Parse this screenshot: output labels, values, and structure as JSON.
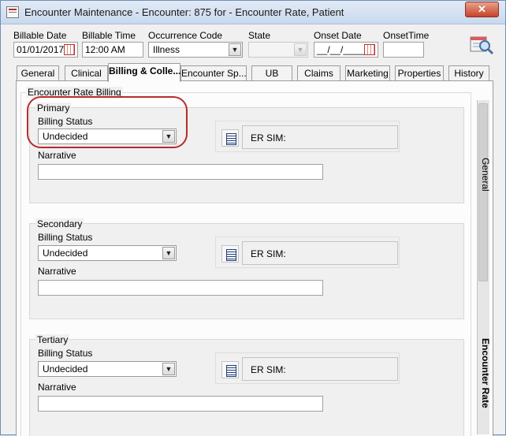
{
  "window": {
    "title": "Encounter Maintenance - Encounter: 875 for - Encounter Rate, Patient",
    "close_glyph": "✕"
  },
  "header_fields": {
    "billable_date": {
      "label": "Billable Date",
      "value": "01/01/2017"
    },
    "billable_time": {
      "label": "Billable Time",
      "value": "12:00 AM"
    },
    "occurrence_code": {
      "label": "Occurrence Code",
      "value": "Illness"
    },
    "state": {
      "label": "State",
      "value": ""
    },
    "onset_date": {
      "label": "Onset Date",
      "value": "__/__/____"
    },
    "onset_time": {
      "label": "OnsetTime",
      "value": ""
    }
  },
  "tabs": [
    {
      "label": "General"
    },
    {
      "label": "Clinical"
    },
    {
      "label": "Billing & Colle..."
    },
    {
      "label": "Encounter  Sp..."
    },
    {
      "label": "UB"
    },
    {
      "label": "Claims"
    },
    {
      "label": "Marketing"
    },
    {
      "label": "Properties"
    },
    {
      "label": "History"
    }
  ],
  "active_tab": "Billing & Colle...",
  "panel": {
    "group_title": "Encounter Rate Billing",
    "sections": [
      {
        "title": "Primary",
        "billing_status_label": "Billing Status",
        "billing_status": "Undecided",
        "er_sim_label": "ER SIM:",
        "narrative_label": "Narrative",
        "narrative": ""
      },
      {
        "title": "Secondary",
        "billing_status_label": "Billing Status",
        "billing_status": "Undecided",
        "er_sim_label": "ER SIM:",
        "narrative_label": "Narrative",
        "narrative": ""
      },
      {
        "title": "Tertiary",
        "billing_status_label": "Billing Status",
        "billing_status": "Undecided",
        "er_sim_label": "ER SIM:",
        "narrative_label": "Narrative",
        "narrative": ""
      }
    ]
  },
  "side_tabs": [
    {
      "label": "General"
    },
    {
      "label": "Encounter Rate"
    }
  ],
  "dropdown_glyph": "▼",
  "colors": {
    "annotation": "#b92a2a",
    "close_button": "#c7432a"
  }
}
